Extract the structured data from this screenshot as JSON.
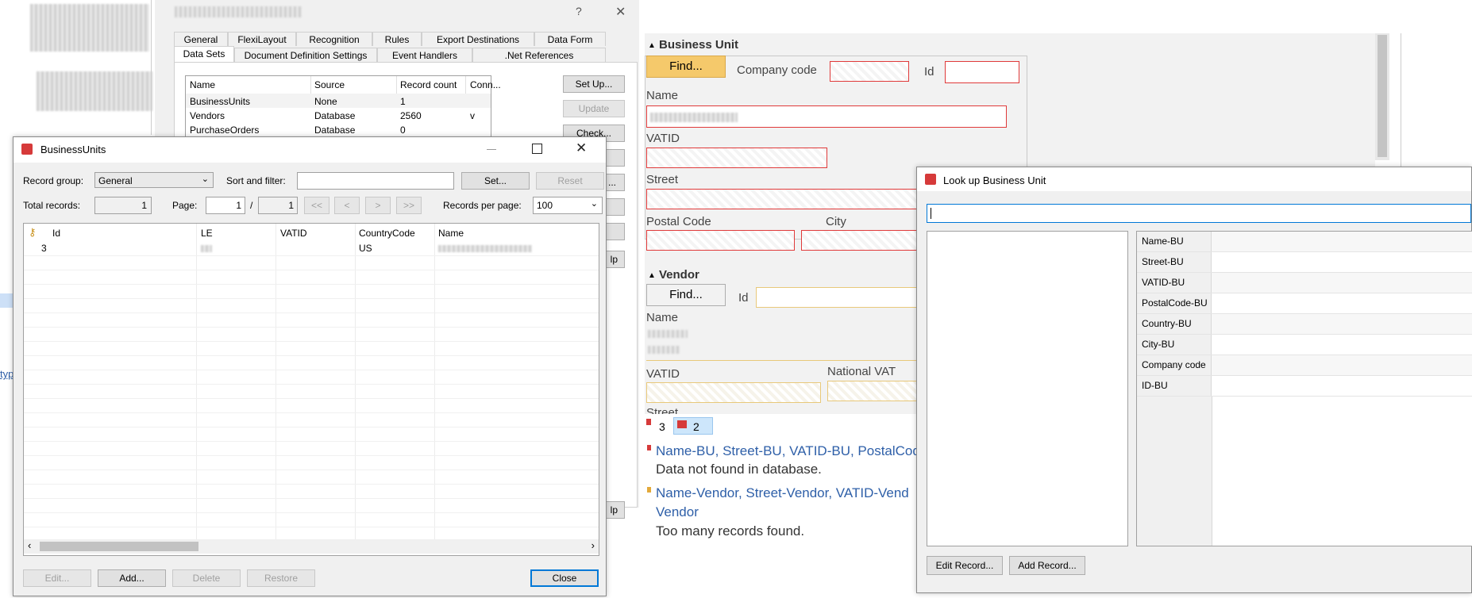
{
  "props_dialog": {
    "title_blurred": "",
    "help_glyph": "?",
    "close_glyph": "✕",
    "tabs_row1": [
      "General",
      "FlexiLayout",
      "Recognition",
      "Rules",
      "Export Destinations",
      "Data Form"
    ],
    "tabs_row2": [
      "Data Sets",
      "Document Definition Settings",
      "Event Handlers",
      ".Net References"
    ],
    "table_headers": [
      "Name",
      "Source",
      "Record count",
      "Conn..."
    ],
    "rows": [
      {
        "name": "BusinessUnits",
        "source": "None",
        "count": "1",
        "conn": ""
      },
      {
        "name": "Vendors",
        "source": "Database",
        "count": "2560",
        "conn": "v"
      },
      {
        "name": "PurchaseOrders",
        "source": "Database",
        "count": "0",
        "conn": ""
      }
    ],
    "buttons": {
      "setup": "Set Up...",
      "update": "Update",
      "check": "Check...",
      "ellipsis": "...",
      "help_partial": "lp",
      "help_partial2": "lp"
    }
  },
  "bu_window": {
    "title": "BusinessUnits",
    "record_group_label": "Record group:",
    "record_group_value": "General",
    "sort_filter_label": "Sort and filter:",
    "set_button": "Set...",
    "reset_button": "Reset",
    "total_records_label": "Total records:",
    "total_records_value": "1",
    "page_label": "Page:",
    "page_value": "1",
    "page_sep": "/",
    "page_total": "1",
    "nav": {
      "first": "<<",
      "prev": "<",
      "next": ">",
      "last": ">>"
    },
    "records_per_page_label": "Records per page:",
    "records_per_page_value": "100",
    "columns": [
      "Id",
      "LE",
      "VATID",
      "CountryCode",
      "Name"
    ],
    "rows": [
      {
        "id": "3",
        "le": "",
        "vatid": "",
        "country": "US",
        "name": ""
      }
    ],
    "buttons": {
      "edit": "Edit...",
      "add": "Add...",
      "delete": "Delete",
      "restore": "Restore",
      "close": "Close"
    }
  },
  "left_edge": {
    "link_text": "typ"
  },
  "form": {
    "bu_section": "Business Unit",
    "find_button": "Find...",
    "company_code_label": "Company code",
    "id_label": "Id",
    "name_label": "Name",
    "vatid_label": "VATID",
    "street_label": "Street",
    "postal_code_label": "Postal Code",
    "city_label": "City",
    "vendor_section": "Vendor",
    "vendor_find_button": "Find...",
    "vendor_id_label": "Id",
    "vendor_name_label": "Name",
    "vendor_vatid_label": "VATID",
    "national_vat_label": "National VAT",
    "vendor_street_label": "Street",
    "errors_count": "3",
    "warnings_count": "2",
    "msg1_links": "Name-BU, Street-BU, VATID-BU, PostalCod",
    "msg1_text": "Data not found in database.",
    "msg2_links": "Name-Vendor, Street-Vendor, VATID-Vend",
    "msg2_links_line2": "Vendor",
    "msg2_text": "Too many records found."
  },
  "lookup": {
    "title": "Look up Business Unit",
    "search_value": "",
    "fields": [
      "Name-BU",
      "Street-BU",
      "VATID-BU",
      "PostalCode-BU",
      "Country-BU",
      "City-BU",
      "Company code",
      "ID-BU"
    ],
    "edit_button": "Edit Record...",
    "add_button": "Add Record..."
  },
  "colors": {
    "accent": "#0078d7",
    "error_red": "#e03a3a",
    "find_orange": "#f5c96b",
    "link_blue": "#2e5fa8"
  }
}
